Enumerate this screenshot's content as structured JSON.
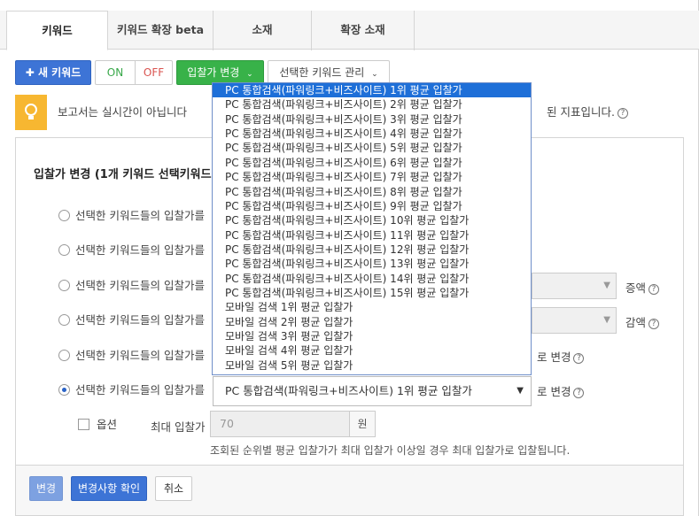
{
  "tabs": [
    {
      "label": "키워드",
      "active": true
    },
    {
      "label": "키워드 확장 beta",
      "active": false
    },
    {
      "label": "소재",
      "active": false
    },
    {
      "label": "확장 소재",
      "active": false
    }
  ],
  "toolbar": {
    "new_keyword": "새 키워드",
    "on": "ON",
    "off": "OFF",
    "bid_change": "입찰가 변경",
    "manage_selected": "선택한 키워드 관리"
  },
  "info": {
    "text": "보고서는 실시간이 아닙니다",
    "tail": "된 지표입니다."
  },
  "panel": {
    "title": "입찰가 변경 (1개 키워드 선택키워드",
    "row_label": "선택한 키워드들의 입찰가를",
    "suffix_increase": "증액",
    "suffix_decrease": "감액",
    "suffix_change": "로 변경",
    "selected_value": "PC 통합검색(파워링크+비즈사이트) 1위 평균 입찰가",
    "option_label": "옵션",
    "max_bid_label": "최대 입찰가",
    "max_bid_value": "70",
    "unit": "원",
    "note": "조회된 순위별 평균 입찰가가 최대 입찰가 이상일 경우 최대 입찰가로 입찰됩니다."
  },
  "footer": {
    "change": "변경",
    "confirm": "변경사항 확인",
    "cancel": "취소"
  },
  "dropdown": {
    "options": [
      "PC 통합검색(파워링크+비즈사이트) 1위 평균 입찰가",
      "PC 통합검색(파워링크+비즈사이트) 2위 평균 입찰가",
      "PC 통합검색(파워링크+비즈사이트) 3위 평균 입찰가",
      "PC 통합검색(파워링크+비즈사이트) 4위 평균 입찰가",
      "PC 통합검색(파워링크+비즈사이트) 5위 평균 입찰가",
      "PC 통합검색(파워링크+비즈사이트) 6위 평균 입찰가",
      "PC 통합검색(파워링크+비즈사이트) 7위 평균 입찰가",
      "PC 통합검색(파워링크+비즈사이트) 8위 평균 입찰가",
      "PC 통합검색(파워링크+비즈사이트) 9위 평균 입찰가",
      "PC 통합검색(파워링크+비즈사이트) 10위 평균 입찰가",
      "PC 통합검색(파워링크+비즈사이트) 11위 평균 입찰가",
      "PC 통합검색(파워링크+비즈사이트) 12위 평균 입찰가",
      "PC 통합검색(파워링크+비즈사이트) 13위 평균 입찰가",
      "PC 통합검색(파워링크+비즈사이트) 14위 평균 입찰가",
      "PC 통합검색(파워링크+비즈사이트) 15위 평균 입찰가",
      "모바일 검색 1위 평균 입찰가",
      "모바일 검색 2위 평균 입찰가",
      "모바일 검색 3위 평균 입찰가",
      "모바일 검색 4위 평균 입찰가",
      "모바일 검색 5위 평균 입찰가"
    ]
  },
  "colors": {
    "blue": "#3d74d6",
    "green": "#38b249",
    "selected": "#1e6fd8",
    "info_icon": "#f7b731"
  }
}
